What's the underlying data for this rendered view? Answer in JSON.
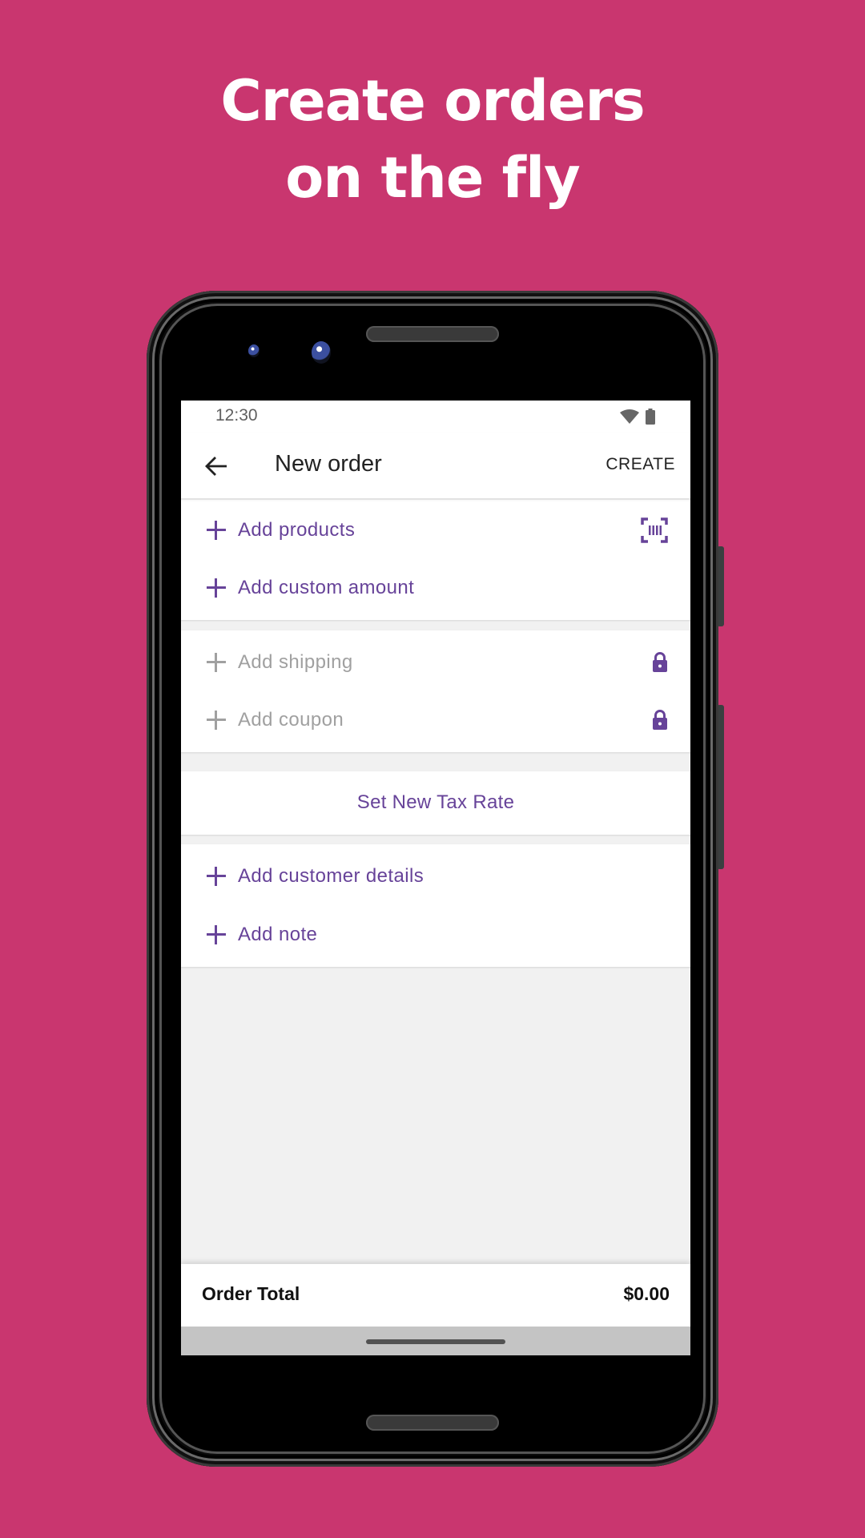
{
  "headline": {
    "line1": "Create orders",
    "line2": "on the fly"
  },
  "colors": {
    "background": "#C9366F",
    "accent": "#674399",
    "disabled": "#A0A0A0"
  },
  "status_bar": {
    "time": "12:30",
    "icons": [
      "wifi-icon",
      "battery-icon"
    ]
  },
  "app_bar": {
    "back_icon": "arrow-left-icon",
    "title": "New order",
    "action_label": "CREATE"
  },
  "products_section": {
    "items": [
      {
        "label": "Add products",
        "icon": "plus-icon",
        "trailing_icon": "barcode-scan-icon"
      },
      {
        "label": "Add custom amount",
        "icon": "plus-icon"
      }
    ]
  },
  "extras_section": {
    "items": [
      {
        "label": "Add shipping",
        "icon": "plus-icon",
        "trailing_icon": "lock-icon",
        "disabled": true
      },
      {
        "label": "Add coupon",
        "icon": "plus-icon",
        "trailing_icon": "lock-icon",
        "disabled": true
      }
    ]
  },
  "tax_section": {
    "button_label": "Set New Tax Rate"
  },
  "customer_section": {
    "items": [
      {
        "label": "Add customer details",
        "icon": "plus-icon"
      },
      {
        "label": "Add note",
        "icon": "plus-icon"
      }
    ]
  },
  "footer": {
    "total_label": "Order Total",
    "total_value": "$0.00"
  }
}
